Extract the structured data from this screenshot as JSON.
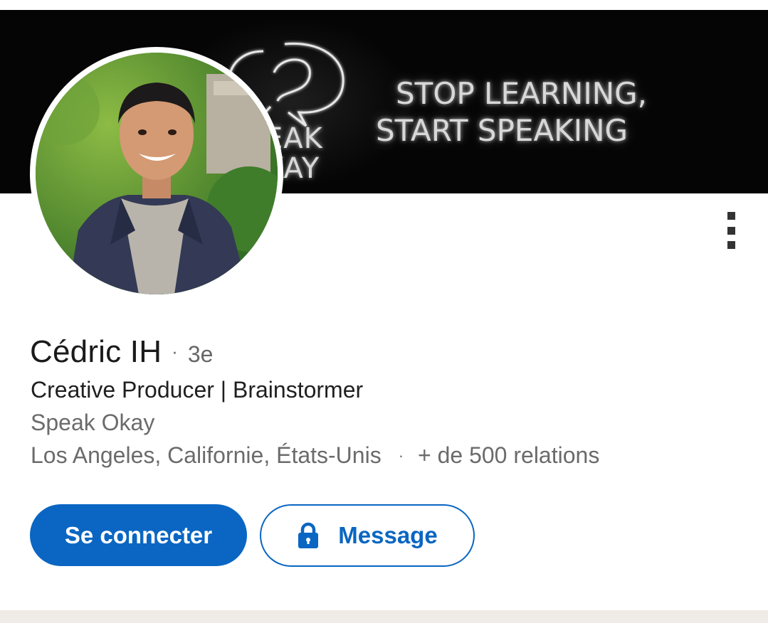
{
  "banner": {
    "logo_text": "EAK\nKAY",
    "tagline_line1": "STOP LEARNING,",
    "tagline_line2": "START SPEAKING"
  },
  "profile": {
    "name": "Cédric IH",
    "separator": "·",
    "degree": "3e",
    "headline": "Creative Producer | Brainstormer",
    "company": "Speak Okay",
    "location": "Los Angeles, Californie, États-Unis",
    "location_separator": "·",
    "connections": "+ de 500 relations"
  },
  "actions": {
    "connect_label": "Se connecter",
    "message_label": "Message",
    "message_icon": "lock-icon",
    "more_icon": "more-vertical-icon"
  },
  "colors": {
    "accent": "#0a66c2",
    "banner_bg": "#050505",
    "text_primary": "#1a1a1a",
    "text_secondary": "#6b6b6b"
  }
}
